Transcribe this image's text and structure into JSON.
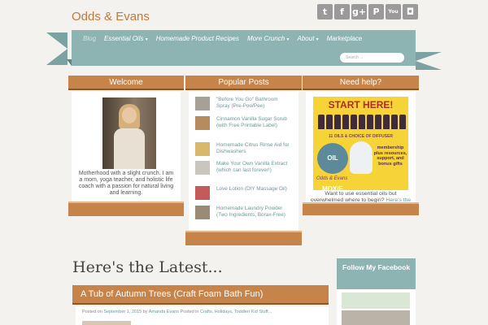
{
  "site": {
    "title": "Odds & Evans"
  },
  "social": [
    {
      "icon": "twitter-icon",
      "glyph": "t"
    },
    {
      "icon": "facebook-icon",
      "glyph": "f"
    },
    {
      "icon": "google-plus-icon",
      "glyph": "g+"
    },
    {
      "icon": "pinterest-icon",
      "glyph": "P"
    },
    {
      "icon": "youtube-icon",
      "glyph": "You"
    },
    {
      "icon": "instagram-icon",
      "glyph": "◘"
    }
  ],
  "nav": {
    "items": [
      {
        "label": "Blog"
      },
      {
        "label": "Essential Oils",
        "caret": "▾"
      },
      {
        "label": "Homemade Product Recipes"
      },
      {
        "label": "More Crunch",
        "caret": "▾"
      },
      {
        "label": "About",
        "caret": "▾"
      },
      {
        "label": "Marketplace"
      }
    ],
    "search_placeholder": "Search ..."
  },
  "welcome": {
    "title": "Welcome",
    "text": "Motherhood with a slight crunch. I am a mom, yoga teacher, and holistic life coach with a passion for natural living and learning."
  },
  "popular": {
    "title": "Popular Posts",
    "posts": [
      "\"Before You Go\" Bathroom Spray (Pre-Poo/Pee)",
      "Cinnamon Vanilla Sugar Scrub (with Free Printable Label)",
      "Homemade Citrus Rinse Aid for Dishwashers",
      "Make Your Own Vanilla Extract (which can last forever!)",
      "Love Lotion (DIY Massage Oil)",
      "Homemade Laundry Powder (Two Ingredients, Borax-Free)"
    ]
  },
  "help": {
    "title": "Need help?",
    "promo": {
      "banner": "START HERE!",
      "sub": "11 OILS & CHOICE OF DIFFUSER",
      "moxie": "OIL MOXIE",
      "membership": "membership plus resources, support, and bonus gifts",
      "logo": "Odds & Evans"
    },
    "text": "Want to use essential oils but overwhelmed where to begin?",
    "link": "Here's the best way to start your journey!"
  },
  "latest": {
    "heading": "Here's the Latest...",
    "post_title": "A Tub of Autumn Trees (Craft Foam Bath Fun)",
    "meta_prefix": "Posted on",
    "meta_date": "September 1, 2015",
    "meta_by": "by",
    "meta_author": "Amanda Evans",
    "meta_in": "Posted in",
    "meta_cats": "Crafts, Holidays, Toddler/ Kid Stuff..."
  },
  "facebook": {
    "title": "Follow My Facebook"
  },
  "colors": {
    "accent_orange": "#c6844a",
    "teal": "#8db4b3",
    "link": "#6b9a99"
  }
}
